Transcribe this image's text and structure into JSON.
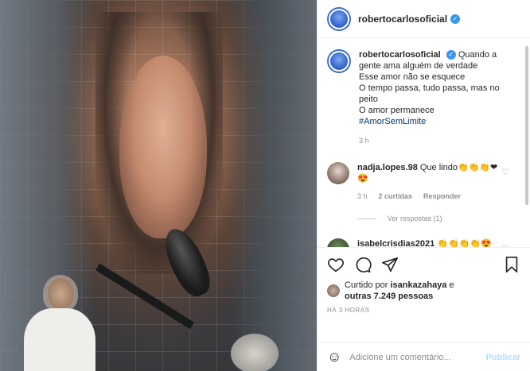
{
  "post": {
    "username": "robertocarlosoficial",
    "caption": {
      "username": "robertocarlosoficial",
      "lines": [
        "Quando a gente ama alguém de verdade",
        "Esse amor não se esquece",
        "O tempo passa, tudo passa, mas no peito",
        "O amor permanece"
      ],
      "hashtag": "#AmorSemLimite",
      "time": "3 h"
    },
    "comments": [
      {
        "username": "nadja.lopes.98",
        "text": "Que lindo👏👏👏❤😍",
        "time": "3 h",
        "likes": "2 curtidas",
        "reply": "Responder",
        "view_replies": "Ver respostas (1)"
      },
      {
        "username": "isabelcrisdias2021",
        "text": "👏👏👏👏😍😍😍😍😍😍"
      }
    ],
    "likes": {
      "prefix": "Curtido por",
      "user": "isankazahaya",
      "connector": "e",
      "others": "outras 7.249 pessoas"
    },
    "timestamp": "HÁ 3 HORAS",
    "add_comment": {
      "placeholder": "Adicione um comentário...",
      "publish": "Publicar"
    }
  },
  "icons": [
    "heart-icon",
    "comment-icon",
    "share-icon",
    "bookmark-icon",
    "emoji-icon",
    "verified-icon"
  ],
  "colors": {
    "verified": "#3897f0",
    "hashtag": "#00376b",
    "publish": "#b2dffc",
    "muted": "#8e8e8e"
  }
}
